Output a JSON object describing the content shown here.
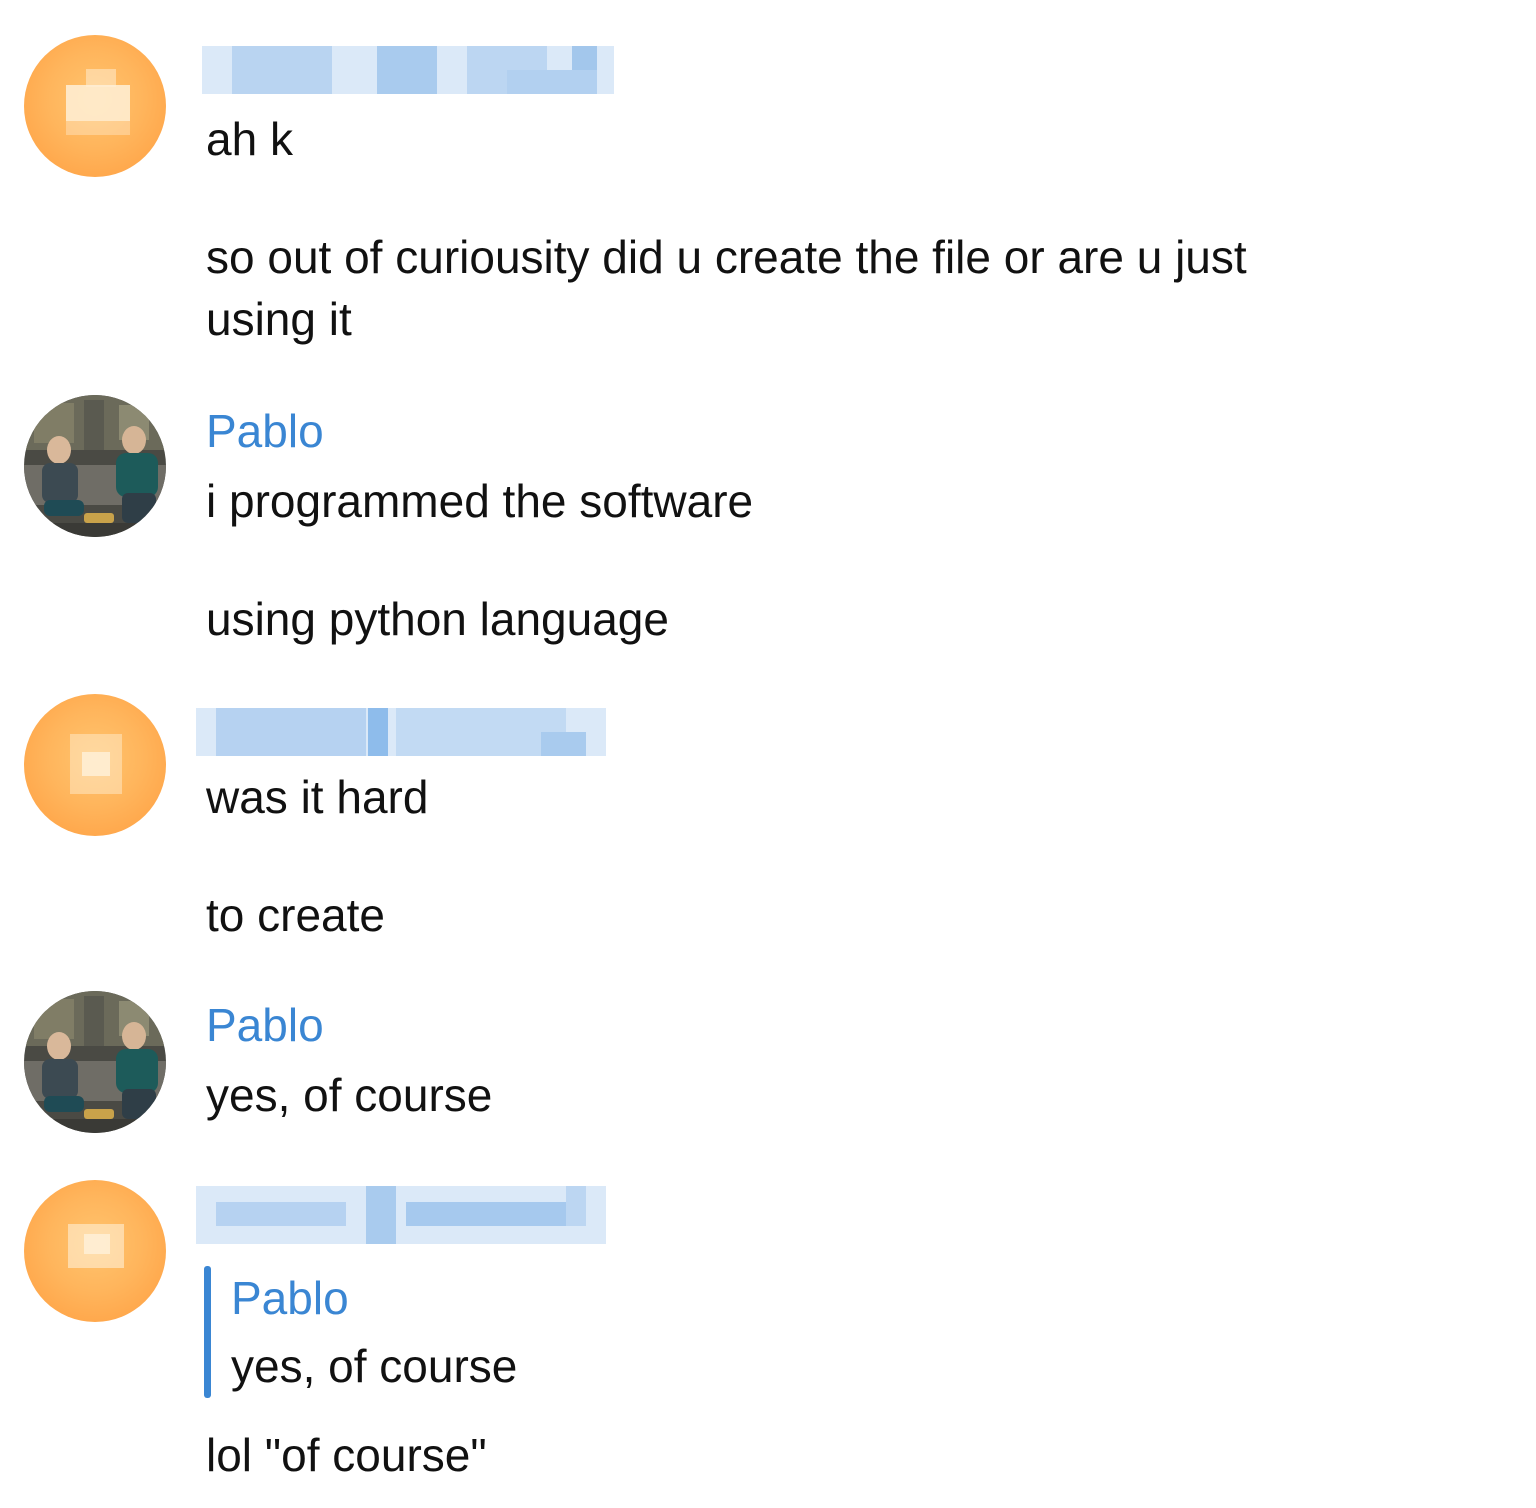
{
  "messages": [
    {
      "sender": "",
      "sender_redacted": true,
      "avatar": "orange-pixelated-avatar",
      "lines": [
        "ah k",
        "so out of curiousity did u create the file or are u just",
        "using it"
      ]
    },
    {
      "sender": "Pablo",
      "avatar": "photo-avatar",
      "lines": [
        "i programmed the software",
        "using python language"
      ]
    },
    {
      "sender": "",
      "sender_redacted": true,
      "avatar": "orange-pixelated-avatar",
      "lines": [
        "was it hard",
        "to create"
      ]
    },
    {
      "sender": "Pablo",
      "avatar": "photo-avatar",
      "lines": [
        "yes, of course"
      ]
    },
    {
      "sender": "",
      "sender_redacted": true,
      "avatar": "orange-pixelated-avatar",
      "reply": {
        "sender": "Pablo",
        "text": "yes, of course"
      },
      "lines": [
        "lol \"of course\""
      ]
    }
  ],
  "colors": {
    "sender_name": "#3a86d3",
    "reply_bar": "#3a86d3",
    "avatar_orange": "#ffb55c",
    "redaction_blue": "#a9cbee",
    "text": "#111111",
    "background": "#ffffff"
  }
}
